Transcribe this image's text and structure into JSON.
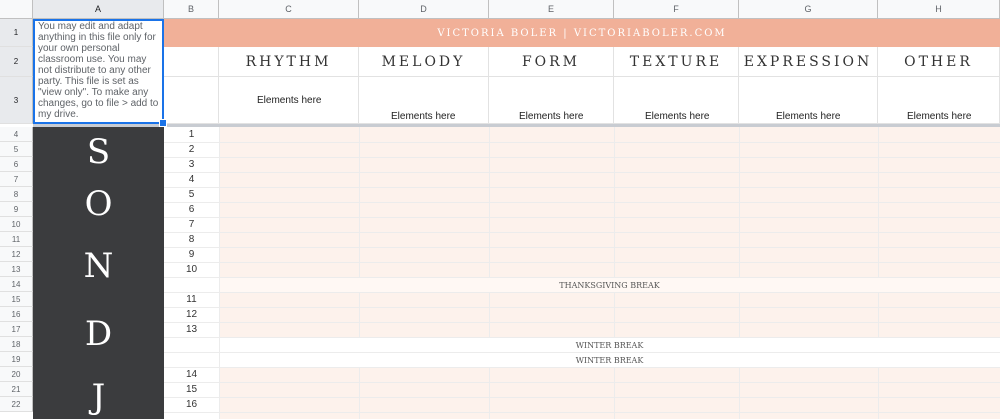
{
  "columns": [
    "A",
    "B",
    "C",
    "D",
    "E",
    "F",
    "G",
    "H"
  ],
  "row_numbers": [
    "1",
    "2",
    "3",
    "4",
    "5",
    "6",
    "7",
    "8",
    "9",
    "10",
    "11",
    "12",
    "13",
    "14",
    "15",
    "16",
    "17",
    "18",
    "19",
    "20",
    "21",
    "22"
  ],
  "note": "You may edit and adapt anything in this file only for your own personal classroom use. You may not distribute to any other party. This file is set as \"view only\". To make any changes, go to file > add to my drive.",
  "banner": "VICTORIA BOLER | VICTORIABOLER.COM",
  "categories": [
    "RHYTHM",
    "MELODY",
    "FORM",
    "TEXTURE",
    "EXPRESSION",
    "OTHER"
  ],
  "elements_label": "Elements here",
  "months": [
    "S",
    "O",
    "N",
    "D",
    "J"
  ],
  "week_numbers": [
    "1",
    "2",
    "3",
    "4",
    "5",
    "6",
    "7",
    "8",
    "9",
    "10",
    "11",
    "12",
    "13",
    "14",
    "15",
    "16"
  ],
  "breaks": {
    "thanksgiving": "THANKSGIVING BREAK",
    "winter_1": "WINTER BREAK",
    "winter_2": "WINTER BREAK"
  },
  "colors": {
    "banner_bg": "#f1b098",
    "dark_column": "#3b3c3e",
    "selection": "#1a73e8",
    "row_tint": "#fdf2ec"
  }
}
